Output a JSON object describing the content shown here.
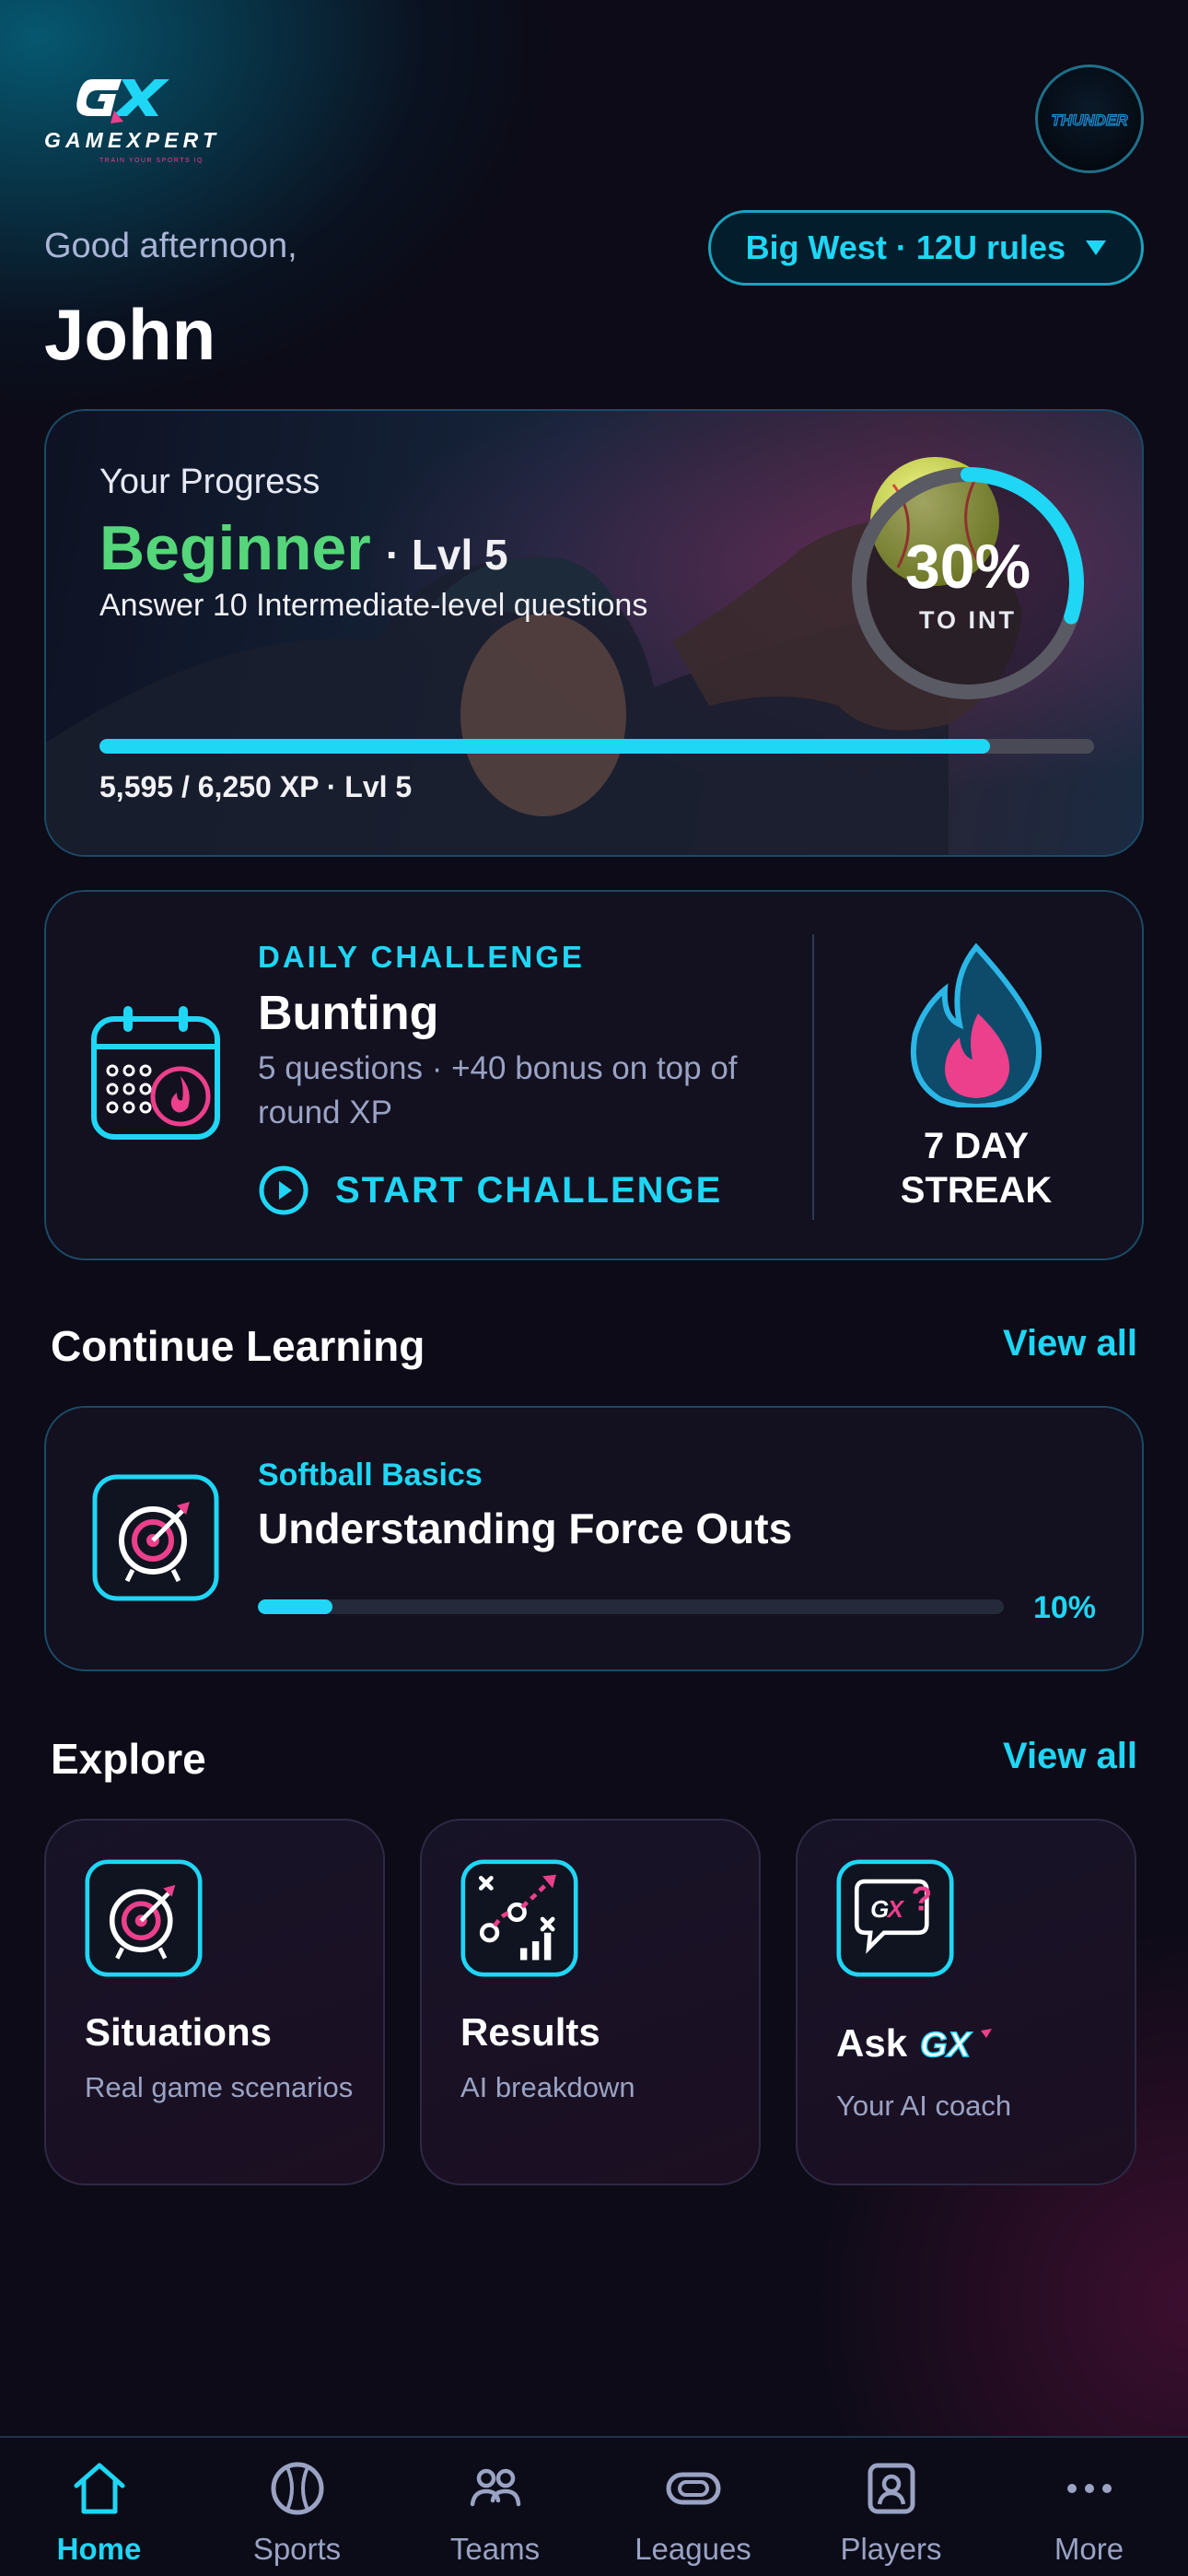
{
  "header": {
    "logo_text": "GAMEXPERT",
    "logo_tagline": "TRAIN YOUR SPORTS IQ",
    "greeting": "Good afternoon,",
    "user_name": "John",
    "avatar_text": "THUNDER",
    "league_selector": "Big West · 12U rules"
  },
  "progress": {
    "label": "Your Progress",
    "level_name": "Beginner",
    "level_suffix": "· Lvl 5",
    "task": "Answer 10 Intermediate-level questions",
    "xp_text": "5,595 / 6,250 XP · Lvl 5",
    "xp_fraction": 0.8952,
    "ring_percent": "30%",
    "ring_fraction": 0.3,
    "ring_sub": "TO INT"
  },
  "daily_challenge": {
    "kicker": "DAILY CHALLENGE",
    "title": "Bunting",
    "description": "5 questions · +40 bonus on top of round XP",
    "cta": "START CHALLENGE",
    "streak_line1": "7 DAY",
    "streak_line2": "STREAK"
  },
  "continue_learning": {
    "title": "Continue Learning",
    "view_all": "View all",
    "course": {
      "category": "Softball Basics",
      "title": "Understanding Force Outs",
      "progress_text": "10%",
      "progress_fraction": 0.1
    }
  },
  "explore": {
    "title": "Explore",
    "view_all": "View all",
    "cards": [
      {
        "title": "Situations",
        "subtitle": "Real game scenarios",
        "icon": "target-icon"
      },
      {
        "title": "Results",
        "subtitle": "AI breakdown",
        "icon": "strategy-chart-icon"
      },
      {
        "title": "Ask",
        "brand": "GX",
        "subtitle": "Your AI coach",
        "icon": "chat-bubble-icon"
      }
    ]
  },
  "bottom_nav": {
    "items": [
      {
        "label": "Home",
        "icon": "home-icon",
        "active": true
      },
      {
        "label": "Sports",
        "icon": "ball-icon",
        "active": false
      },
      {
        "label": "Teams",
        "icon": "users-icon",
        "active": false
      },
      {
        "label": "Leagues",
        "icon": "leagues-icon",
        "active": false
      },
      {
        "label": "Players",
        "icon": "player-icon",
        "active": false
      },
      {
        "label": "More",
        "icon": "more-icon",
        "active": false
      }
    ]
  },
  "colors": {
    "accent": "#1fd6f5",
    "level_green": "#55d67a",
    "pink": "#ec3f8c",
    "background": "#0c0b17"
  }
}
